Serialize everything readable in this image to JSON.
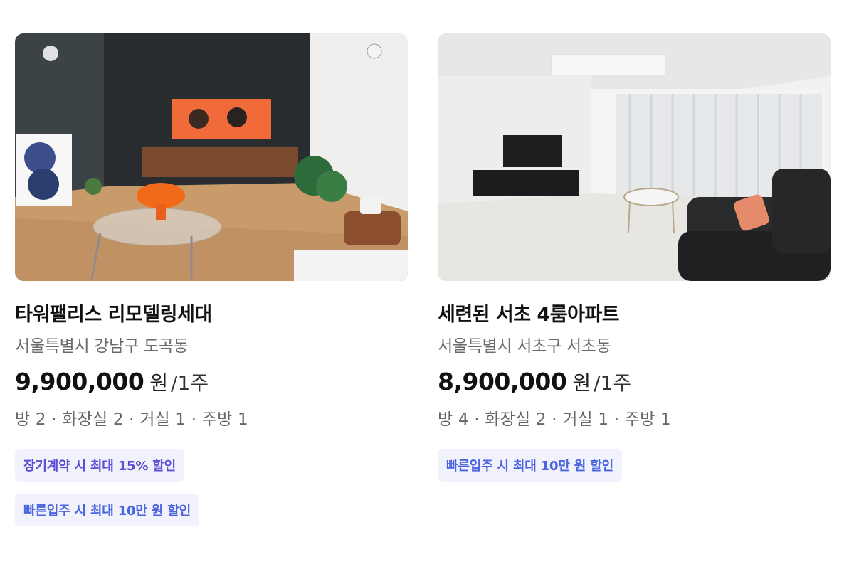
{
  "listings": [
    {
      "image_label": "living-room-dark-wall",
      "title": "타워팰리스 리모델링세대",
      "address": "서울특별시 강남구 도곡동",
      "price": "9,900,000",
      "currency": "원",
      "period": "/1주",
      "rooms": "방 2 · 화장실 2 · 거실 1 · 주방 1",
      "tags": [
        {
          "text": "장기계약 시 최대 15% 할인",
          "color": "#5a4fd6"
        },
        {
          "text": "빠른입주 시 최대 10만 원 할인",
          "color": "#4a64e0"
        }
      ]
    },
    {
      "image_label": "living-room-white-marble",
      "title": "세련된 서초 4룸아파트",
      "address": "서울특별시 서초구 서초동",
      "price": "8,900,000",
      "currency": "원",
      "period": "/1주",
      "rooms": "방 4 · 화장실 2 · 거실 1 · 주방 1",
      "tags": [
        {
          "text": "빠른입주 시 최대 10만 원 할인",
          "color": "#4a64e0"
        }
      ]
    }
  ]
}
